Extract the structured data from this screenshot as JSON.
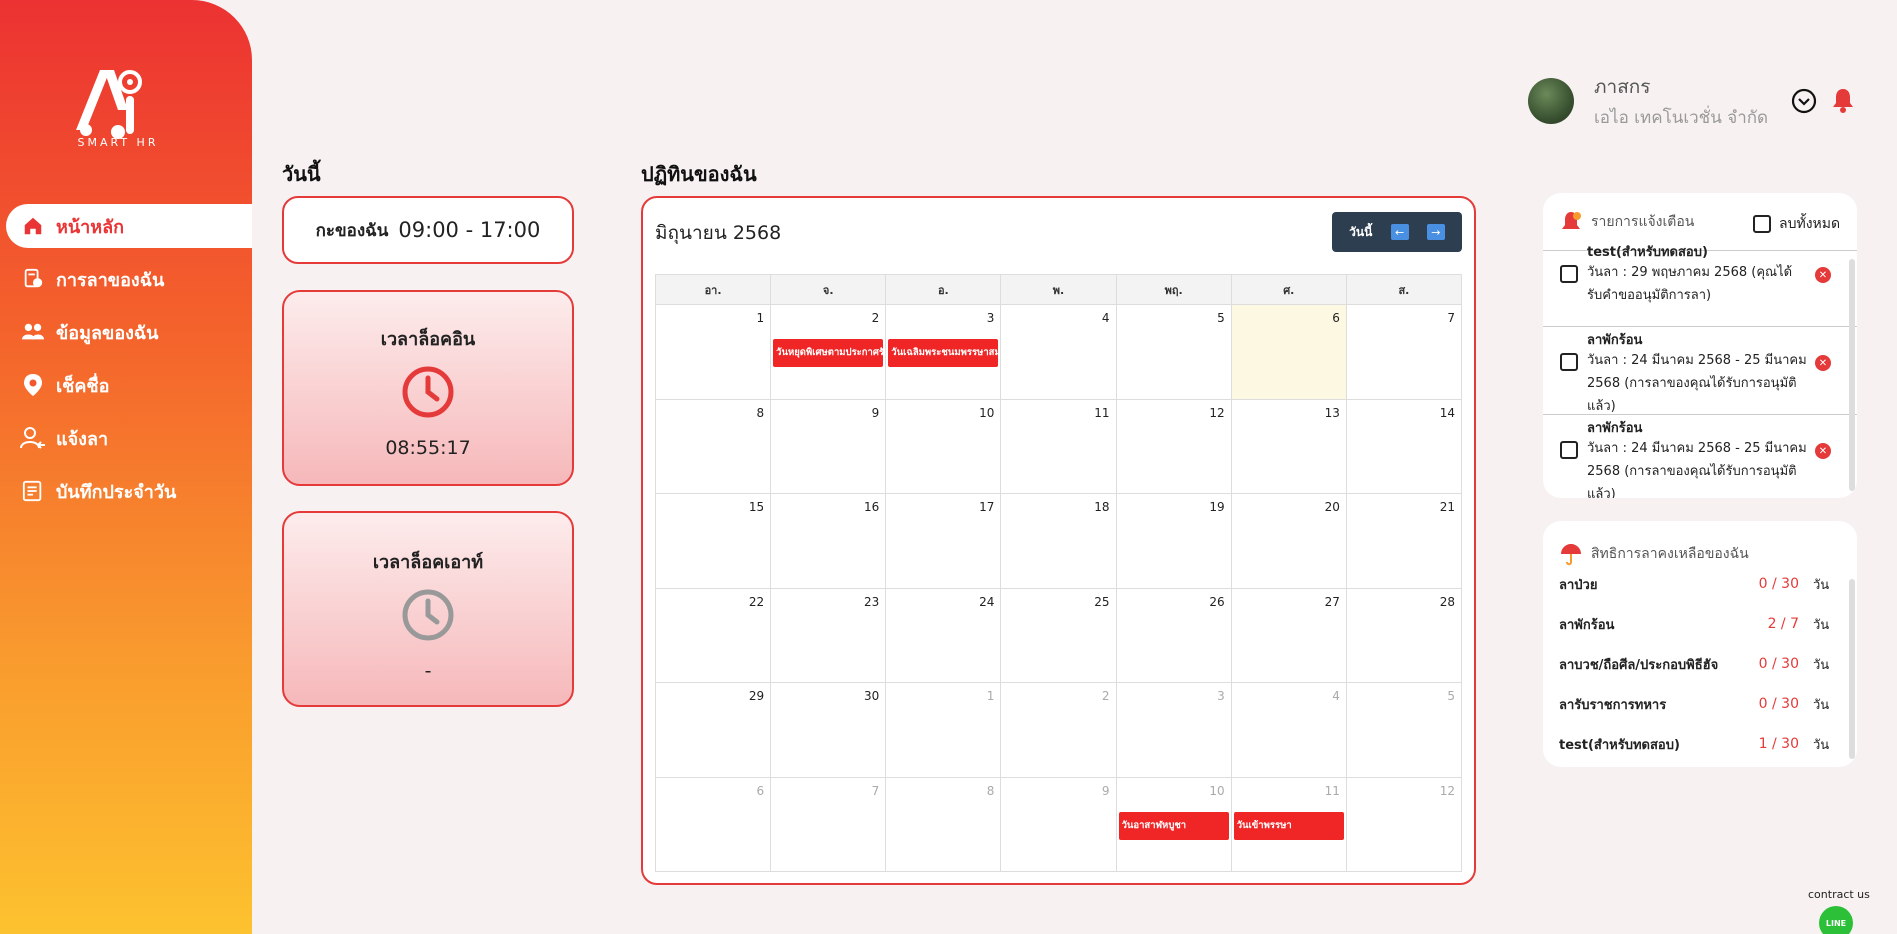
{
  "brand": {
    "logo_text": "Ai",
    "logo_sub": "SMART HR"
  },
  "nav": {
    "items": [
      {
        "label": "หน้าหลัก",
        "icon": "home-icon",
        "active": true
      },
      {
        "label": "การลาของฉัน",
        "icon": "leave-document-icon"
      },
      {
        "label": "ข้อมูลของฉัน",
        "icon": "team-icon"
      },
      {
        "label": "เช็คชื่อ",
        "icon": "location-pin-icon"
      },
      {
        "label": "แจ้งลา",
        "icon": "user-leave-icon"
      },
      {
        "label": "บันทึกประจำวัน",
        "icon": "daily-log-icon"
      }
    ]
  },
  "today": {
    "heading": "วันนี้",
    "shift_label": "กะของฉัน",
    "shift_time": "09:00 - 17:00",
    "clock_in": {
      "title": "เวลาล็อคอิน",
      "value": "08:55:17"
    },
    "clock_out": {
      "title": "เวลาล็อคเอาท์",
      "value": "-"
    }
  },
  "calendar": {
    "heading": "ปฏิทินของฉัน",
    "month": "มิถุนายน 2568",
    "today_button": "วันนี้",
    "weekdays": [
      "อา.",
      "จ.",
      "อ.",
      "พ.",
      "พฤ.",
      "ศ.",
      "ส."
    ],
    "weeks": [
      [
        {
          "d": "1"
        },
        {
          "d": "2",
          "ev": "วันหยุดพิเศษตามประกาศรัฐ"
        },
        {
          "d": "3",
          "ev": "วันเฉลิมพระชนมพรรษาสมเด็"
        },
        {
          "d": "4"
        },
        {
          "d": "5"
        },
        {
          "d": "6",
          "today": true
        },
        {
          "d": "7"
        }
      ],
      [
        {
          "d": "8"
        },
        {
          "d": "9"
        },
        {
          "d": "10"
        },
        {
          "d": "11"
        },
        {
          "d": "12"
        },
        {
          "d": "13"
        },
        {
          "d": "14"
        }
      ],
      [
        {
          "d": "15"
        },
        {
          "d": "16"
        },
        {
          "d": "17"
        },
        {
          "d": "18"
        },
        {
          "d": "19"
        },
        {
          "d": "20"
        },
        {
          "d": "21"
        }
      ],
      [
        {
          "d": "22"
        },
        {
          "d": "23"
        },
        {
          "d": "24"
        },
        {
          "d": "25"
        },
        {
          "d": "26"
        },
        {
          "d": "27"
        },
        {
          "d": "28"
        }
      ],
      [
        {
          "d": "29"
        },
        {
          "d": "30"
        },
        {
          "d": "1",
          "other": true
        },
        {
          "d": "2",
          "other": true
        },
        {
          "d": "3",
          "other": true
        },
        {
          "d": "4",
          "other": true
        },
        {
          "d": "5",
          "other": true
        }
      ],
      [
        {
          "d": "6",
          "other": true
        },
        {
          "d": "7",
          "other": true
        },
        {
          "d": "8",
          "other": true
        },
        {
          "d": "9",
          "other": true
        },
        {
          "d": "10",
          "other": true,
          "ev": "วันอาสาฬหบูชา"
        },
        {
          "d": "11",
          "other": true,
          "ev": "วันเข้าพรรษา"
        },
        {
          "d": "12",
          "other": true
        }
      ]
    ]
  },
  "user": {
    "name": "ภาสกร",
    "company": "เอไอ เทคโนเวชั่น จำกัด"
  },
  "notifications": {
    "title": "รายการแจ้งเตือน",
    "clear_all": "ลบทั้งหมด",
    "items": [
      {
        "title": "test(สำหรับทดสอบ)",
        "detail": "วันลา : 29 พฤษภาคม 2568 (คุณได้รับคำขออนุมัติการลา)"
      },
      {
        "title": "ลาพักร้อน",
        "detail": "วันลา : 24 มีนาคม 2568 - 25 มีนาคม 2568 (การลาของคุณได้รับการอนุมัติแล้ว)"
      },
      {
        "title": "ลาพักร้อน",
        "detail": "วันลา : 24 มีนาคม 2568 - 25 มีนาคม 2568 (การลาของคุณได้รับการอนุมัติแล้ว)"
      }
    ]
  },
  "leave_balance": {
    "title": "สิทธิการลาคงเหลือของฉัน",
    "unit": "วัน",
    "rows": [
      {
        "name": "ลาป่วย",
        "used": "0 / 30"
      },
      {
        "name": "ลาพักร้อน",
        "used": "2 / 7"
      },
      {
        "name": "ลาบวช/ถือศีล/ประกอบพิธีฮัจ",
        "used": "0 / 30"
      },
      {
        "name": "ลารับราชการทหาร",
        "used": "0 / 30"
      },
      {
        "name": "test(สำหรับทดสอบ)",
        "used": "1 / 30"
      }
    ]
  },
  "contact": {
    "label": "contract us",
    "line": "LINE"
  },
  "colors": {
    "accent": "#e53a3a",
    "sidebar_top": "#ec3232",
    "sidebar_bottom": "#fdc22f",
    "event": "#f02525"
  }
}
